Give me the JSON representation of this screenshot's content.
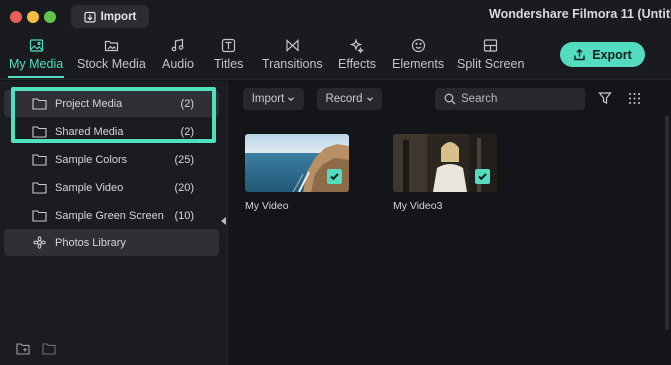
{
  "window": {
    "import_button": "Import",
    "title": "Wondershare Filmora 11 (Untitl"
  },
  "tabs": [
    {
      "label": "My Media",
      "icon": "image-icon",
      "active": true
    },
    {
      "label": "Stock Media",
      "icon": "folder-image-icon",
      "active": false
    },
    {
      "label": "Audio",
      "icon": "music-icon",
      "active": false
    },
    {
      "label": "Titles",
      "icon": "text-icon",
      "active": false
    },
    {
      "label": "Transitions",
      "icon": "transition-icon",
      "active": false
    },
    {
      "label": "Effects",
      "icon": "sparkle-icon",
      "active": false
    },
    {
      "label": "Elements",
      "icon": "smile-icon",
      "active": false
    },
    {
      "label": "Split Screen",
      "icon": "split-screen-icon",
      "active": false
    }
  ],
  "export_button": "Export",
  "sidebar": {
    "items": [
      {
        "label": "Project Media",
        "count": "(2)",
        "icon": "folder-icon",
        "selected": true
      },
      {
        "label": "Shared Media",
        "count": "(2)",
        "icon": "folder-icon",
        "selected": false
      },
      {
        "label": "Sample Colors",
        "count": "(25)",
        "icon": "folder-icon",
        "selected": false
      },
      {
        "label": "Sample Video",
        "count": "(20)",
        "icon": "folder-icon",
        "selected": false
      },
      {
        "label": "Sample Green Screen",
        "count": "(10)",
        "icon": "folder-icon",
        "selected": false
      },
      {
        "label": "Photos Library",
        "count": "",
        "icon": "photos-icon",
        "selected": true
      }
    ]
  },
  "toolbar": {
    "import_label": "Import",
    "record_label": "Record",
    "search_placeholder": "Search"
  },
  "media": [
    {
      "label": "My Video",
      "checked": true
    },
    {
      "label": "My Video3",
      "checked": true
    }
  ],
  "colors": {
    "accent": "#53dcc0",
    "highlight_box": "#4fe0bd",
    "background": "#141518",
    "panel": "#1b1c1f"
  }
}
